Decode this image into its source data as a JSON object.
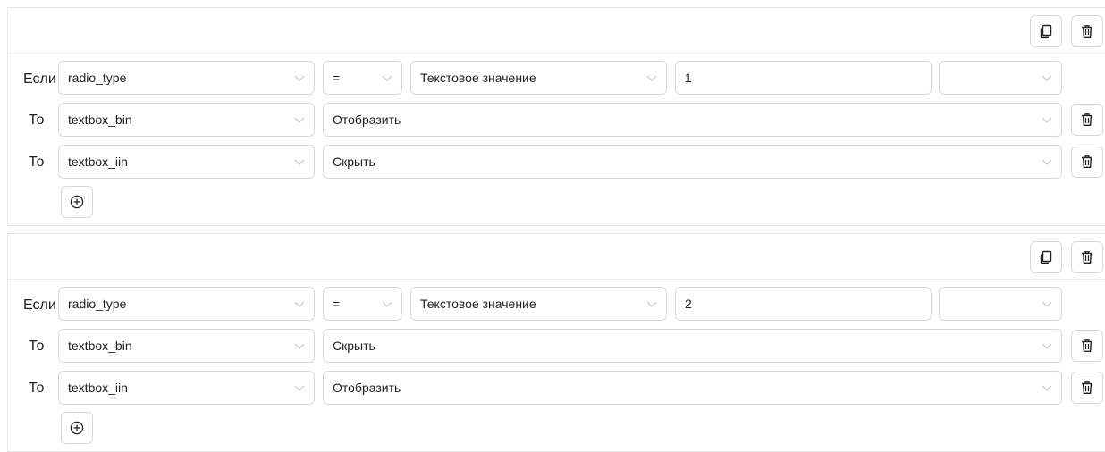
{
  "icons": {
    "copy": "copy-icon",
    "delete": "trash-icon",
    "add": "plus-circle-icon",
    "chevron": "chevron-down-icon"
  },
  "rules": [
    {
      "if_label": "Если",
      "condition": {
        "field": "radio_type",
        "operator": "=",
        "value_type": "Текстовое значение",
        "value": "1",
        "extra": ""
      },
      "actions": [
        {
          "label": "То",
          "field": "textbox_bin",
          "action": "Отобразить"
        },
        {
          "label": "То",
          "field": "textbox_iin",
          "action": "Скрыть"
        }
      ]
    },
    {
      "if_label": "Если",
      "condition": {
        "field": "radio_type",
        "operator": "=",
        "value_type": "Текстовое значение",
        "value": "2",
        "extra": ""
      },
      "actions": [
        {
          "label": "То",
          "field": "textbox_bin",
          "action": "Скрыть"
        },
        {
          "label": "То",
          "field": "textbox_iin",
          "action": "Отобразить"
        }
      ]
    }
  ]
}
